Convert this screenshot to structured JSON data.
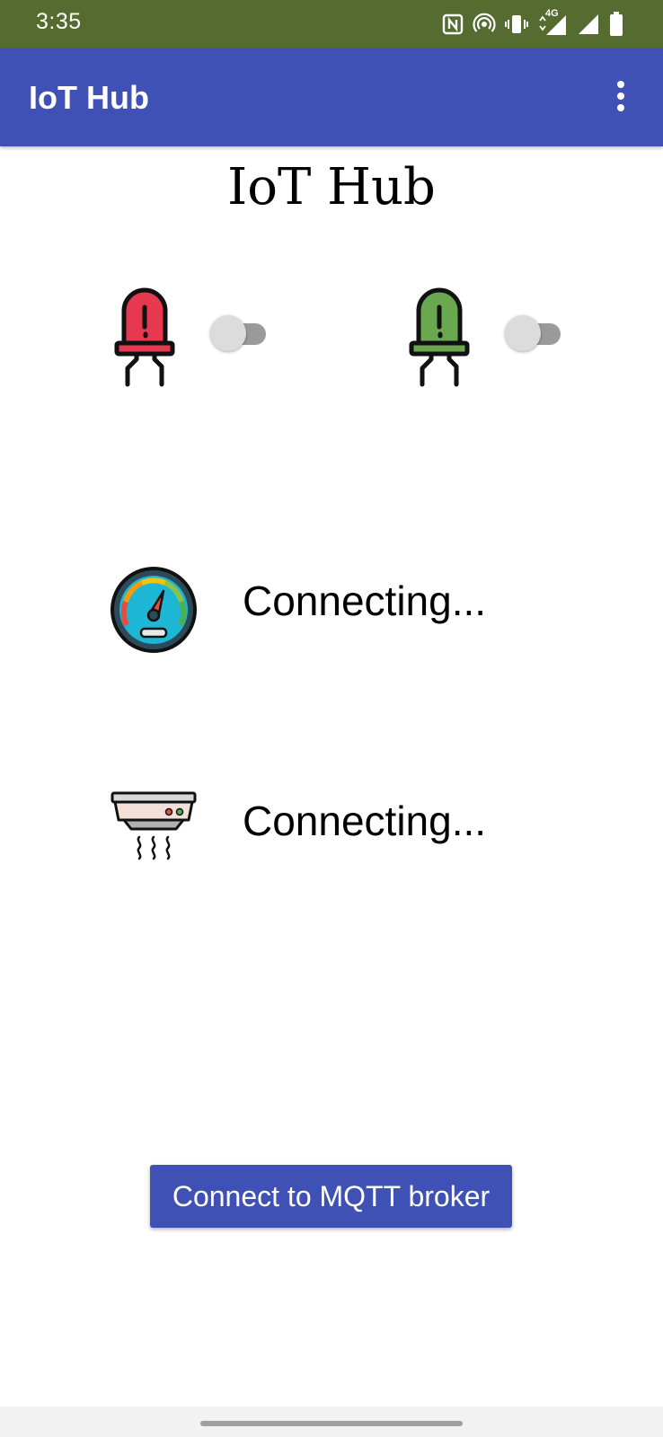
{
  "status_bar": {
    "time": "3:35",
    "network_label": "4G",
    "icons": [
      "nfc-icon",
      "hotspot-icon",
      "vibrate-icon",
      "signal-4g-icon",
      "signal-icon",
      "battery-icon"
    ],
    "background": "#556b2f"
  },
  "app_bar": {
    "title": "IoT Hub",
    "menu_icon": "more-vert-icon",
    "background": "#3f51b5"
  },
  "main": {
    "heading": "IoT Hub",
    "leds": [
      {
        "name": "red-led",
        "icon": "red-led-icon",
        "color": "#e63950",
        "switch_on": false
      },
      {
        "name": "green-led",
        "icon": "green-led-icon",
        "color": "#6aa84f",
        "switch_on": false
      }
    ],
    "sensors": [
      {
        "icon": "gauge-icon",
        "status": "Connecting..."
      },
      {
        "icon": "smoke-detector-icon",
        "status": "Connecting..."
      }
    ],
    "connect_button": "Connect to MQTT broker"
  },
  "colors": {
    "primary": "#3f51b5",
    "status_bar": "#556b2f"
  }
}
